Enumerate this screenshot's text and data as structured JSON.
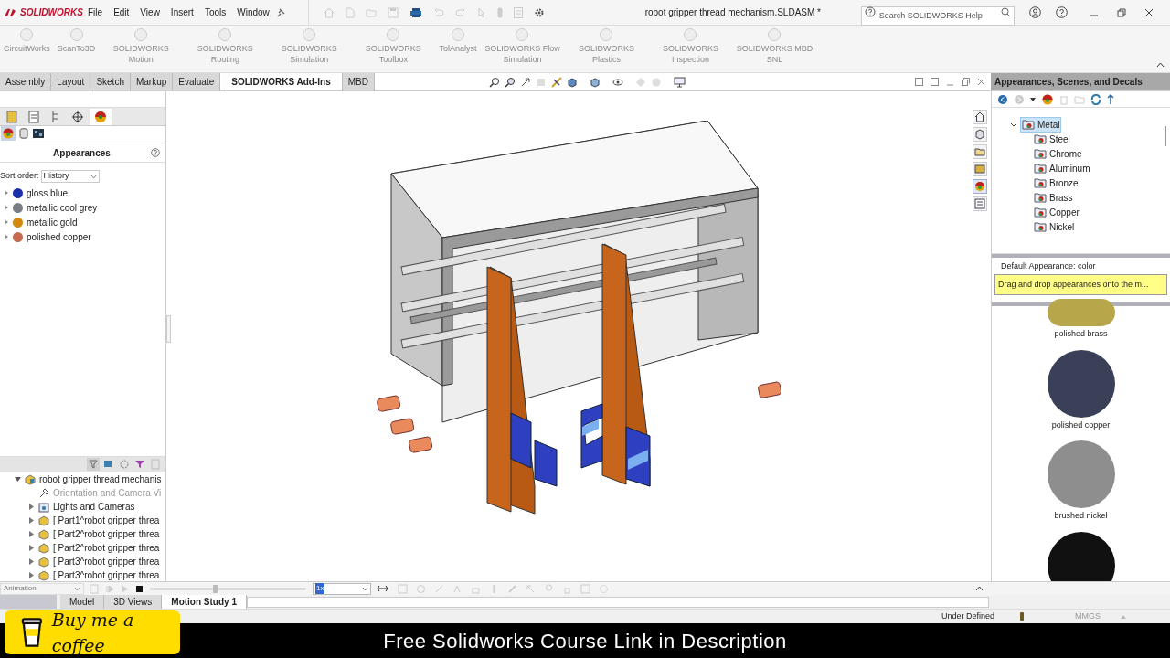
{
  "app": {
    "logo": "SOLIDWORKS",
    "menu": [
      "File",
      "Edit",
      "View",
      "Insert",
      "Tools",
      "Window"
    ],
    "title": "robot gripper thread mechanism.SLDASM *",
    "search": {
      "placeholder": "Search SOLIDWORKS Help"
    }
  },
  "addins": [
    {
      "label": "CircuitWorks"
    },
    {
      "label": "ScanTo3D"
    },
    {
      "label": "SOLIDWORKS Motion"
    },
    {
      "label": "SOLIDWORKS Routing"
    },
    {
      "label": "SOLIDWORKS Simulation"
    },
    {
      "label": "SOLIDWORKS Toolbox"
    },
    {
      "label": "TolAnalyst"
    },
    {
      "label": "SOLIDWORKS Flow Simulation"
    },
    {
      "label": "SOLIDWORKS Plastics"
    },
    {
      "label": "SOLIDWORKS Inspection"
    },
    {
      "label": "SOLIDWORKS MBD SNL"
    }
  ],
  "command_tabs": [
    {
      "label": "Assembly",
      "selected": false
    },
    {
      "label": "Layout",
      "selected": false
    },
    {
      "label": "Sketch",
      "selected": false
    },
    {
      "label": "Markup",
      "selected": false
    },
    {
      "label": "Evaluate",
      "selected": false
    },
    {
      "label": "SOLIDWORKS Add-Ins",
      "selected": true
    },
    {
      "label": "MBD",
      "selected": false
    }
  ],
  "left_panel": {
    "title": "Appearances",
    "sort_label": "Sort order:",
    "sort_value": "History",
    "appearances": [
      {
        "name": "gloss blue",
        "color": "#1a2fa8"
      },
      {
        "name": "metallic cool grey",
        "color": "#7a7d85"
      },
      {
        "name": "metallic gold",
        "color": "#d08a10"
      },
      {
        "name": "polished copper",
        "color": "#c46a50"
      }
    ]
  },
  "feature_tree": {
    "label": "robot gripper thread mechanis",
    "expanded": true,
    "children": [
      {
        "label": "Orientation and Camera Vi",
        "kind": "camera"
      },
      {
        "label": "Lights and Cameras",
        "kind": "folder"
      },
      {
        "label": "[ Part1^robot gripper threa",
        "kind": "part"
      },
      {
        "label": "[ Part2^robot gripper threa",
        "kind": "part"
      },
      {
        "label": "[ Part2^robot gripper threa",
        "kind": "part"
      },
      {
        "label": "[ Part3^robot gripper threa",
        "kind": "part"
      },
      {
        "label": "[ Part3^robot gripper threa",
        "kind": "part"
      }
    ]
  },
  "right_panel": {
    "title": "Appearances, Scenes, and Decals",
    "tree": [
      {
        "label": "Metal",
        "selected": true,
        "expanded": true,
        "children": [
          {
            "label": "Steel"
          },
          {
            "label": "Chrome"
          },
          {
            "label": "Aluminum"
          },
          {
            "label": "Bronze"
          },
          {
            "label": "Brass"
          },
          {
            "label": "Copper"
          },
          {
            "label": "Nickel"
          }
        ]
      }
    ],
    "default_appearance": "Default Appearance: color",
    "hint": "Drag and drop appearances onto the m...",
    "swatches": [
      {
        "label": "polished brass",
        "color": "#b8a64a"
      },
      {
        "label": "polished copper",
        "color": "#3a4058"
      },
      {
        "label": "brushed nickel",
        "color": "#8e8e8e"
      },
      {
        "color": "#111111"
      }
    ]
  },
  "motion_study": {
    "type": "Animation",
    "timeline": {
      "level": 0.42
    },
    "speed": "1x",
    "tabs": [
      {
        "label": "Model",
        "selected": false
      },
      {
        "label": "3D Views",
        "selected": false
      },
      {
        "label": "Motion Study 1",
        "selected": true
      }
    ]
  },
  "status_bar": {
    "state": "Under Defined",
    "units": "MMGS"
  },
  "overlay": {
    "button": "Buy me a coffee",
    "caption": "Free Solidworks Course Link in Description"
  }
}
